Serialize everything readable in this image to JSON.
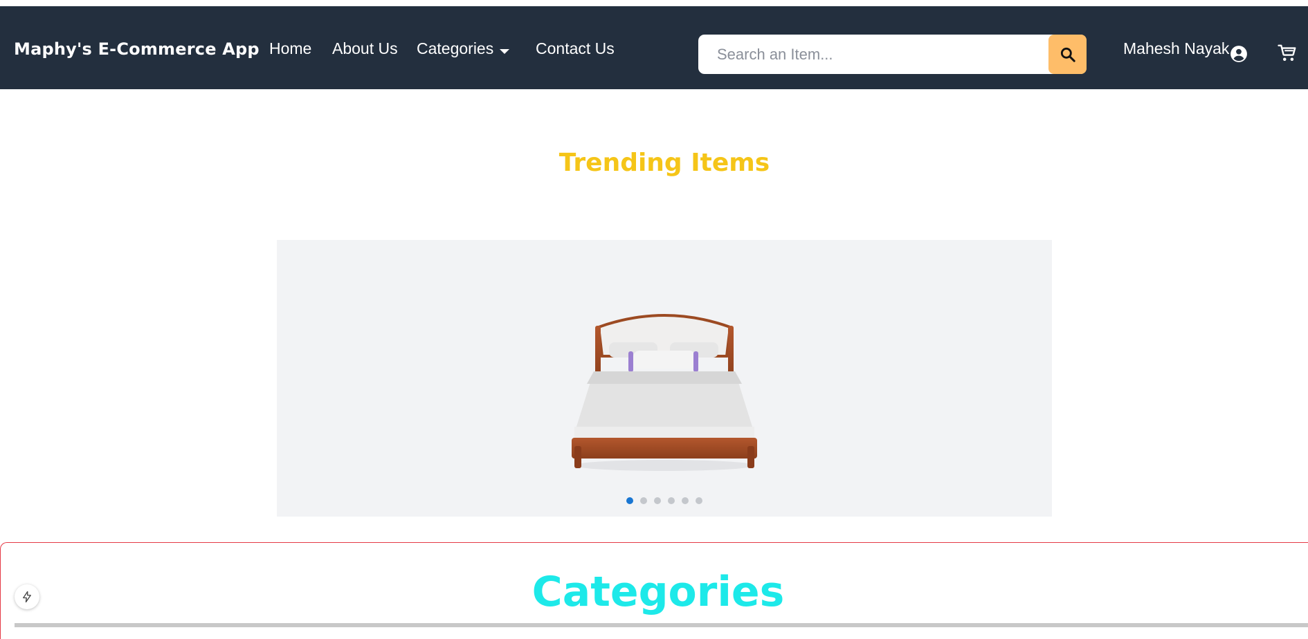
{
  "navbar": {
    "brand": "Maphy's E-Commerce App",
    "links": {
      "home": "Home",
      "about": "About Us",
      "categories": "Categories",
      "contact": "Contact Us"
    },
    "search_placeholder": "Search an Item...",
    "user_name": "Mahesh Nayak",
    "colors": {
      "background": "#232f3e",
      "search_button": "#febd69"
    }
  },
  "trending": {
    "title": "Trending Items",
    "title_color": "#f5c518",
    "slide_count": 6,
    "active_slide": 1,
    "current_image": "wooden-bed-with-white-bedding"
  },
  "categories": {
    "title": "Categories",
    "title_color": "#1de9e9",
    "border_color": "#e53945"
  },
  "icons": {
    "search": "search-icon",
    "user": "account-circle-icon",
    "cart": "shopping-cart-icon",
    "caret": "chevron-down-icon",
    "fab": "lightning-bolt-icon"
  }
}
